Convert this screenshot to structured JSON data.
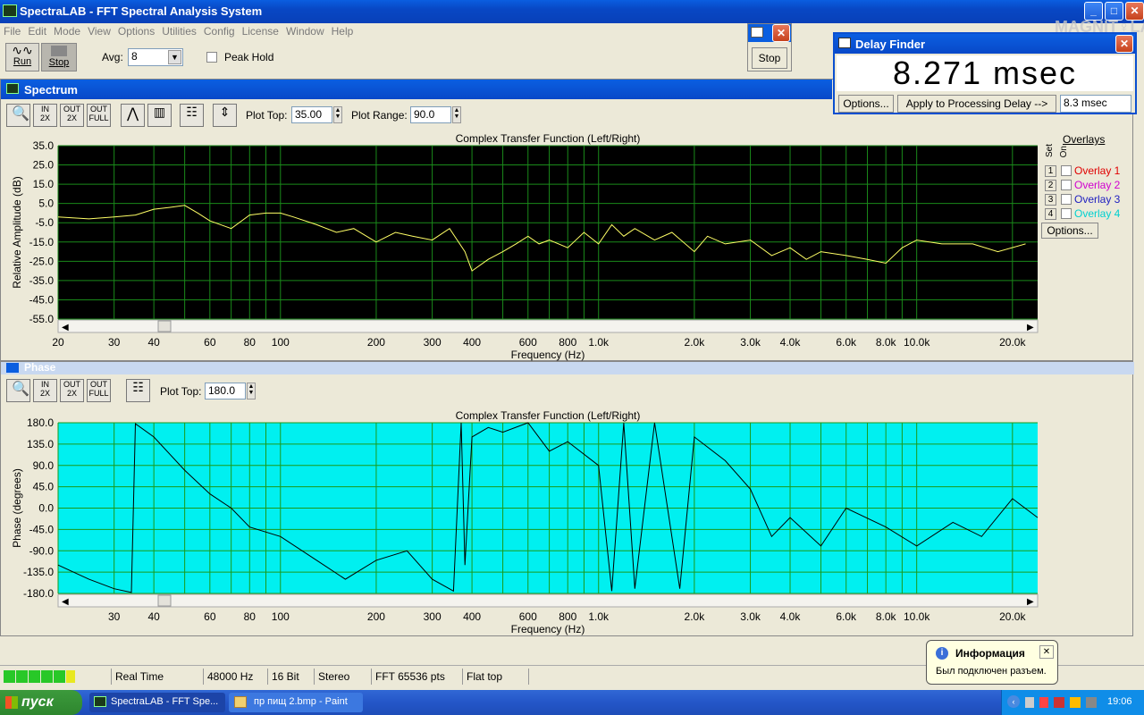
{
  "app": {
    "title": "SpectraLAB - FFT Spectral Analysis System"
  },
  "menu": [
    "File",
    "Edit",
    "Mode",
    "View",
    "Options",
    "Utilities",
    "Config",
    "License",
    "Window",
    "Help"
  ],
  "toolbar": {
    "run_label": "Run",
    "stop_label": "Stop",
    "avg_label": "Avg:",
    "avg_value": "8",
    "peak_hold_label": "Peak Hold"
  },
  "stop_window": {
    "stop_label": "Stop"
  },
  "delay_finder": {
    "title": "Delay Finder",
    "value": "8.271 msec",
    "options_label": "Options...",
    "apply_label": "Apply to Processing Delay -->",
    "delay_field": "8.3 msec"
  },
  "watermark": "MAGNIT♀LA",
  "spectrum": {
    "title": "Spectrum",
    "plot_top_label": "Plot Top:",
    "plot_top_value": "35.00",
    "plot_range_label": "Plot Range:",
    "plot_range_value": "90.0",
    "overlays_header": "Overlays",
    "set_label": "Set",
    "on_label": "On",
    "overlays": [
      {
        "num": "1",
        "label": "Overlay 1",
        "color": "#e00000"
      },
      {
        "num": "2",
        "label": "Overlay 2",
        "color": "#d000d0"
      },
      {
        "num": "3",
        "label": "Overlay 3",
        "color": "#2020c0"
      },
      {
        "num": "4",
        "label": "Overlay 4",
        "color": "#00d0d0"
      }
    ],
    "options_label": "Options..."
  },
  "phase": {
    "title": "Phase",
    "plot_top_label": "Plot Top:",
    "plot_top_value": "180.0"
  },
  "status": {
    "real_time": "Real Time",
    "rate": "48000 Hz",
    "bits": "16 Bit",
    "channels": "Stereo",
    "fft": "FFT 65536 pts",
    "window": "Flat top"
  },
  "balloon": {
    "title": "Информация",
    "text": "Был подключен разъем."
  },
  "taskbar": {
    "start": "пуск",
    "task1": "SpectraLAB - FFT Spe...",
    "task2": "пр пищ 2.bmp - Paint",
    "clock": "19:06"
  },
  "chart_data": [
    {
      "type": "line",
      "title": "Complex Transfer Function (Left/Right)",
      "xlabel": "Frequency (Hz)",
      "ylabel": "Relative Amplitude (dB)",
      "xscale": "log",
      "xlim": [
        20,
        24000
      ],
      "ylim": [
        -55,
        35
      ],
      "yticks": [
        "35.0",
        "25.0",
        "15.0",
        "5.0",
        "-5.0",
        "-15.0",
        "-25.0",
        "-35.0",
        "-45.0",
        "-55.0"
      ],
      "xticks": [
        "20",
        "30",
        "40",
        "60",
        "80",
        "100",
        "200",
        "300",
        "400",
        "600",
        "800",
        "1.0k",
        "2.0k",
        "3.0k",
        "4.0k",
        "6.0k",
        "8.0k",
        "10.0k",
        "20.0k"
      ],
      "x": [
        20,
        25,
        30,
        35,
        40,
        45,
        50,
        55,
        60,
        70,
        80,
        90,
        100,
        110,
        130,
        150,
        170,
        200,
        230,
        260,
        300,
        340,
        380,
        400,
        450,
        500,
        550,
        600,
        650,
        700,
        800,
        900,
        1000,
        1100,
        1200,
        1300,
        1500,
        1700,
        2000,
        2200,
        2500,
        3000,
        3500,
        4000,
        4500,
        5000,
        6000,
        7000,
        8000,
        9000,
        10000,
        12000,
        15000,
        18000,
        22000
      ],
      "y": [
        -2,
        -3,
        -2,
        -1,
        2,
        3,
        4,
        0,
        -4,
        -8,
        -1,
        0,
        0,
        -2,
        -6,
        -10,
        -8,
        -15,
        -10,
        -12,
        -14,
        -8,
        -20,
        -30,
        -24,
        -20,
        -16,
        -12,
        -16,
        -14,
        -18,
        -10,
        -16,
        -6,
        -12,
        -8,
        -14,
        -10,
        -20,
        -12,
        -16,
        -14,
        -22,
        -18,
        -24,
        -20,
        -22,
        -24,
        -26,
        -18,
        -14,
        -16,
        -16,
        -20,
        -16
      ]
    },
    {
      "type": "line",
      "title": "Complex Transfer Function (Left/Right)",
      "xlabel": "Frequency (Hz)",
      "ylabel": "Phase (degrees)",
      "xscale": "log",
      "xlim": [
        20,
        24000
      ],
      "ylim": [
        -180,
        180
      ],
      "yticks": [
        "180.0",
        "135.0",
        "90.0",
        "45.0",
        "0.0",
        "-45.0",
        "-90.0",
        "-135.0",
        "-180.0"
      ],
      "xticks": [
        "30",
        "40",
        "60",
        "80",
        "100",
        "200",
        "300",
        "400",
        "600",
        "800",
        "1.0k",
        "2.0k",
        "3.0k",
        "4.0k",
        "6.0k",
        "8.0k",
        "10.0k",
        "20.0k"
      ],
      "x": [
        20,
        25,
        30,
        34,
        35,
        40,
        50,
        60,
        70,
        80,
        100,
        130,
        160,
        200,
        250,
        300,
        350,
        370,
        380,
        400,
        450,
        500,
        600,
        700,
        800,
        1000,
        1100,
        1200,
        1300,
        1500,
        1800,
        2000,
        2500,
        3000,
        3500,
        4000,
        5000,
        6000,
        8000,
        10000,
        13000,
        16000,
        20000,
        24000
      ],
      "y": [
        -120,
        -150,
        -170,
        -178,
        178,
        150,
        80,
        30,
        0,
        -40,
        -60,
        -110,
        -150,
        -110,
        -90,
        -150,
        -175,
        180,
        -120,
        150,
        170,
        160,
        180,
        120,
        140,
        90,
        -175,
        180,
        -170,
        180,
        -170,
        150,
        100,
        40,
        -60,
        -20,
        -80,
        0,
        -40,
        -80,
        -30,
        -60,
        20,
        -20
      ]
    }
  ]
}
